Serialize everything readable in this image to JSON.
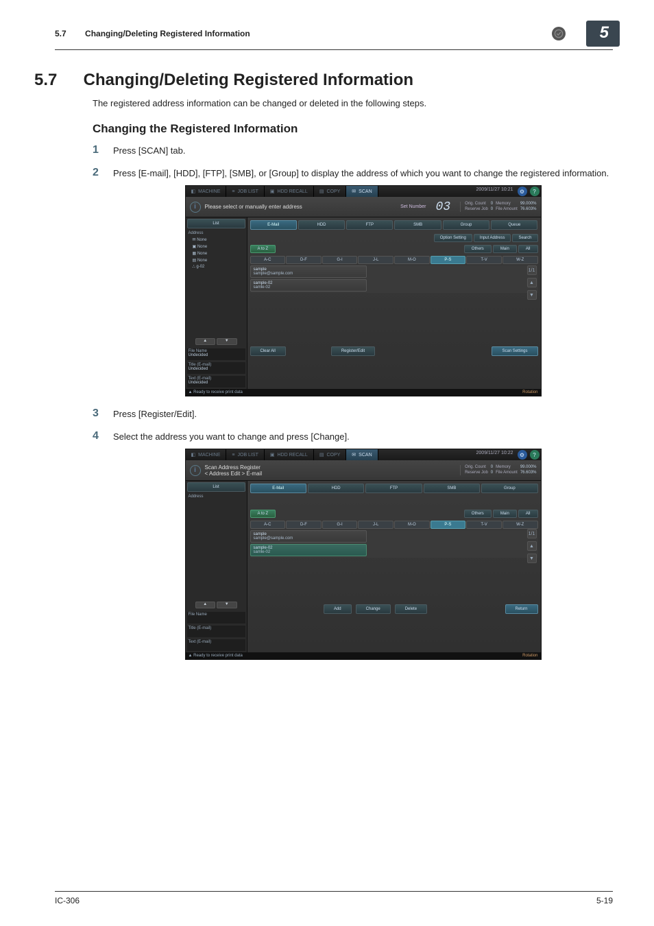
{
  "page_header": {
    "section_number": "5.7",
    "section_title": "Changing/Deleting Registered Information",
    "chapter_number": "5"
  },
  "heading": {
    "number": "5.7",
    "title": "Changing/Deleting Registered Information"
  },
  "intro": "The registered address information can be changed or deleted in the following steps.",
  "subheading": "Changing the Registered Information",
  "steps": {
    "s1": "Press [SCAN] tab.",
    "s2": "Press [E-mail], [HDD], [FTP], [SMB], or [Group] to display the address of which you want to change the registered information.",
    "s3": "Press [Register/Edit].",
    "s4": "Select the address you want to change and press [Change]."
  },
  "shot1": {
    "top_tabs": {
      "machine": "MACHINE",
      "joblist": "JOB LIST",
      "hddrecall": "HDD RECALL",
      "copy": "COPY",
      "scan": "SCAN"
    },
    "timestamp": "2009/11/27 10:21",
    "message": "Please select or manually enter address",
    "set_number_label": "Set Number",
    "set_number_value": "03",
    "stats": {
      "orig_count_l": "Orig. Count",
      "orig_count_v": "0",
      "reserve_l": "Reserve Job",
      "reserve_v": "0",
      "memory_l": "Memory",
      "memory_v": "99.000%",
      "file_l": "File Amount",
      "file_v": "76.603%"
    },
    "side": {
      "list_btn": "List",
      "addr_head": "Address",
      "addr_none": "None",
      "scan_none1": "None",
      "scan_none2": "None",
      "scan_none3": "None",
      "scan_g": "g-02",
      "up": "▲",
      "down": "▼",
      "fn_l": "File Name",
      "fn_v": "Undecided",
      "title_l": "Title (E-mail)",
      "title_v": "Undecided",
      "text_l": "Text (E-mail)",
      "text_v": "Undecided"
    },
    "tabs": {
      "email": "E-Mail",
      "hdd": "HDD",
      "ftp": "FTP",
      "smb": "SMB",
      "group": "Group",
      "queue": "Queue"
    },
    "subtabs": {
      "option": "Option Setting",
      "input": "Input Address",
      "search": "Search"
    },
    "groups": {
      "atoz": "A to Z",
      "others": "Others",
      "main": "Main",
      "all": "All"
    },
    "letters": [
      "A-C",
      "D-F",
      "G-I",
      "J-L",
      "M-O",
      "P-S",
      "T-V",
      "W-Z"
    ],
    "addr1": {
      "name": "sample",
      "email": "sample@sample.com"
    },
    "addr2": {
      "name": "sample-02",
      "email": "samle-02"
    },
    "sidebtn": {
      "frac": "1/1",
      "up": "▲",
      "down": "▼"
    },
    "bottom": {
      "clear": "Clear All",
      "regedit": "Register/Edit",
      "scanset": "Scan Settings"
    },
    "status": {
      "ready": "Ready to receive print data",
      "rotation": "Rotation"
    }
  },
  "shot2": {
    "top_tabs": {
      "machine": "MACHINE",
      "joblist": "JOB LIST",
      "hddrecall": "HDD RECALL",
      "copy": "COPY",
      "scan": "SCAN"
    },
    "timestamp": "2009/11/27 10:22",
    "message1": "Scan Address Register",
    "message2": "< Address Edit > E-mail",
    "stats": {
      "orig_count_l": "Orig. Count",
      "orig_count_v": "0",
      "reserve_l": "Reserve Job",
      "reserve_v": "0",
      "memory_l": "Memory",
      "memory_v": "99.000%",
      "file_l": "File Amount",
      "file_v": "76.603%"
    },
    "side": {
      "list_btn": "List",
      "addr_head": "Address",
      "up": "▲",
      "down": "▼",
      "fn_l": "File Name",
      "title_l": "Title (E-mail)",
      "text_l": "Text (E-mail)"
    },
    "tabs": {
      "email": "E-Mail",
      "hdd": "HDD",
      "ftp": "FTP",
      "smb": "SMB",
      "group": "Group"
    },
    "groups": {
      "atoz": "A to Z",
      "others": "Others",
      "main": "Main",
      "all": "All"
    },
    "letters": [
      "A-C",
      "D-F",
      "G-I",
      "J-L",
      "M-O",
      "P-S",
      "T-V",
      "W-Z"
    ],
    "addr1": {
      "name": "sample",
      "email": "sample@sample.com"
    },
    "addr2": {
      "name": "sample-02",
      "email": "samle-02"
    },
    "sidebtn": {
      "frac": "1/1",
      "up": "▲",
      "down": "▼"
    },
    "bottom": {
      "add": "Add",
      "change": "Change",
      "delete": "Delete",
      "ret": "Return"
    },
    "status": {
      "ready": "Ready to receive print data",
      "rotation": "Rotation"
    }
  },
  "footer": {
    "left": "IC-306",
    "right": "5-19"
  }
}
